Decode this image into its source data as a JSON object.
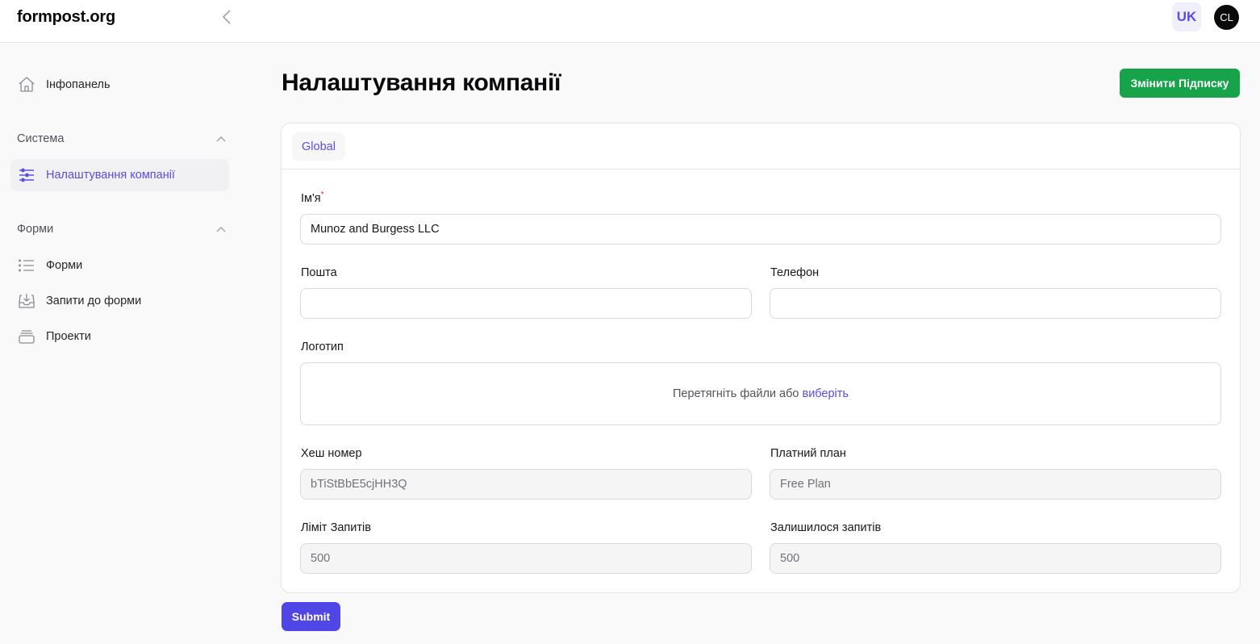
{
  "header": {
    "brand": "formpost.org",
    "language": "UK",
    "user_initials": "CL"
  },
  "sidebar": {
    "dashboard": "Інфопанель",
    "groups": [
      {
        "label": "Система",
        "items": [
          {
            "label": "Налаштування компанії",
            "icon": "sliders-icon",
            "active": true
          }
        ]
      },
      {
        "label": "Форми",
        "items": [
          {
            "label": "Форми",
            "icon": "list-icon"
          },
          {
            "label": "Запити до форми",
            "icon": "inbox-download-icon"
          },
          {
            "label": "Проекти",
            "icon": "stack-icon"
          }
        ]
      }
    ]
  },
  "page": {
    "title": "Налаштування компанії",
    "change_subscription": "Змінити Підписку",
    "tabs": [
      {
        "label": "Global",
        "active": true
      }
    ],
    "submit": "Submit"
  },
  "form": {
    "name": {
      "label": "Ім'я",
      "required_mark": "*",
      "value": "Munoz and Burgess LLC"
    },
    "email": {
      "label": "Пошта",
      "value": ""
    },
    "phone": {
      "label": "Телефон",
      "value": ""
    },
    "logo": {
      "label": "Логотип",
      "drop_text": "Перетягніть файли або",
      "browse_link": "виберіть"
    },
    "hash": {
      "label": "Хеш номер",
      "value": "bTiStBbE5cjHH3Q"
    },
    "plan": {
      "label": "Платний план",
      "value": "Free Plan"
    },
    "request_limit": {
      "label": "Ліміт Запитів",
      "value": "500"
    },
    "requests_left": {
      "label": "Залишилося запитів",
      "value": "500"
    }
  },
  "colors": {
    "accent": "#5b4ce6",
    "primary_button": "#4f46e5",
    "success_button": "#16a34a"
  }
}
